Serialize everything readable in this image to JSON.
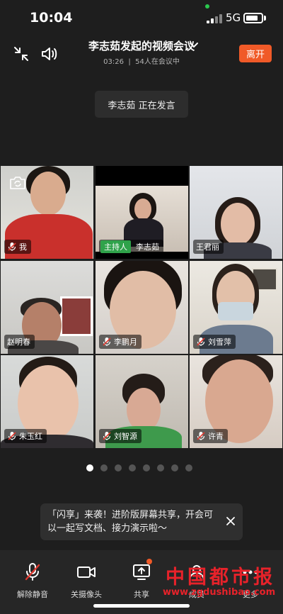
{
  "status": {
    "time": "10:04",
    "network": "5G",
    "battery_level": 0.8
  },
  "meeting": {
    "title": "李志茹发起的视频会议",
    "duration": "03:26",
    "separator": "|",
    "attendees": "54人在会议中",
    "leave_label": "离开",
    "speaking_name": "李志茹",
    "speaking_text": "正在发言"
  },
  "participants": [
    {
      "name": "我"
    },
    {
      "name": "李志茹",
      "role": "主持人"
    },
    {
      "name": "王君丽"
    },
    {
      "name": "赵明春"
    },
    {
      "name": "李鹏月"
    },
    {
      "name": "刘雪萍"
    },
    {
      "name": "朱玉红"
    },
    {
      "name": "刘智源"
    },
    {
      "name": "许青"
    }
  ],
  "pagination": {
    "current": 1,
    "total": 8
  },
  "tip": {
    "text": "「闪享」来袭！进阶版屏幕共享，开会可以一起写文档、接力演示啦～"
  },
  "toolbar": {
    "unmute_label": "解除静音",
    "camera_label": "关摄像头",
    "share_label": "共享",
    "members_label": "成员",
    "more_label": "更多"
  },
  "watermark": {
    "title": "中国都市报",
    "url": "www.zgdushibao.com"
  },
  "colors": {
    "accent": "#f05a28",
    "active_speaker": "#35c759",
    "host_badge": "#2fa24a"
  }
}
